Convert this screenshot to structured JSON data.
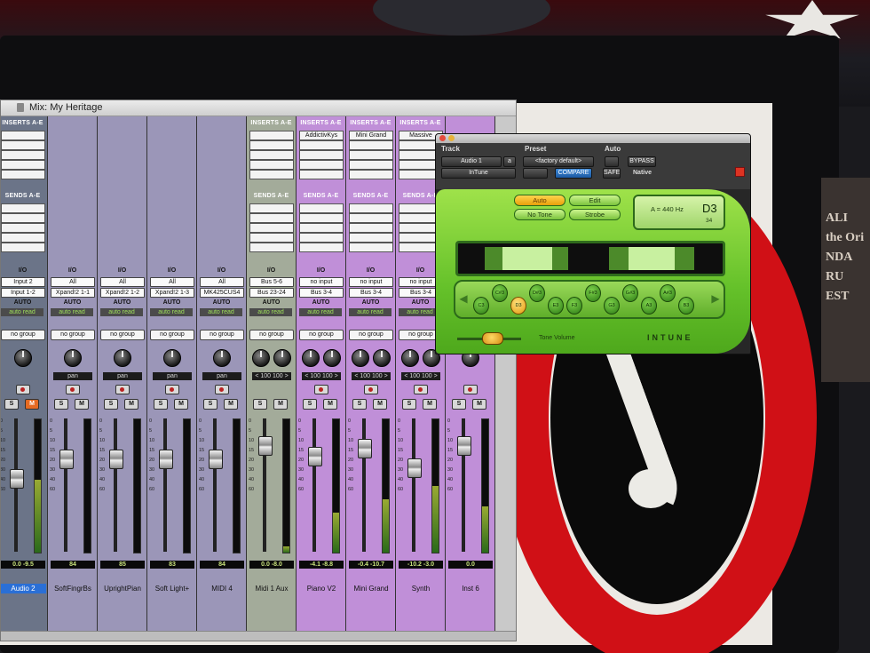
{
  "mix_window": {
    "title": "Mix: My Heritage",
    "strips": [
      {
        "color": "#6b7488",
        "inserts": "INSERTS A-E",
        "insert_slots": [],
        "sends": "SENDS A-E",
        "io": "I/O",
        "input": "Input 2",
        "output": "Input 1-2",
        "automation": "AUTO",
        "auto_mode": "auto read",
        "group": "no group",
        "pan": "",
        "vol_left": "0.0",
        "vol_right": "-9.5",
        "name": "Audio 2",
        "name_selected": true,
        "rec": true,
        "solo_active": false,
        "mute_active": true,
        "fader": 0.55,
        "meter": 0.55
      },
      {
        "color": "#9b96b8",
        "inserts": "",
        "insert_slots": [],
        "sends": "",
        "io": "I/O",
        "input": "All",
        "output": "Xpand!2 1-1",
        "automation": "AUTO",
        "auto_mode": "auto read",
        "group": "no group",
        "pan": "pan",
        "vol_left": "84",
        "vol_right": "",
        "name": "SoftFingrBs",
        "name_selected": false,
        "rec": true,
        "solo_active": false,
        "mute_active": false,
        "fader": 0.7,
        "meter": 0.0
      },
      {
        "color": "#9b96b8",
        "inserts": "",
        "insert_slots": [],
        "sends": "",
        "io": "I/O",
        "input": "All",
        "output": "Xpand!2 1-2",
        "automation": "AUTO",
        "auto_mode": "auto read",
        "group": "no group",
        "pan": "pan",
        "vol_left": "85",
        "vol_right": "",
        "name": "UprightPian",
        "name_selected": false,
        "rec": true,
        "solo_active": false,
        "mute_active": false,
        "fader": 0.7,
        "meter": 0.0
      },
      {
        "color": "#9b96b8",
        "inserts": "",
        "insert_slots": [],
        "sends": "",
        "io": "I/O",
        "input": "All",
        "output": "Xpand!2 1-3",
        "automation": "AUTO",
        "auto_mode": "auto read",
        "group": "no group",
        "pan": "pan",
        "vol_left": "83",
        "vol_right": "",
        "name": "Soft Light+",
        "name_selected": false,
        "rec": true,
        "solo_active": false,
        "mute_active": false,
        "fader": 0.7,
        "meter": 0.0
      },
      {
        "color": "#9b96b8",
        "inserts": "",
        "insert_slots": [],
        "sends": "",
        "io": "I/O",
        "input": "All",
        "output": "MK425CUS4",
        "automation": "AUTO",
        "auto_mode": "auto read",
        "group": "no group",
        "pan": "pan",
        "vol_left": "84",
        "vol_right": "",
        "name": "MIDI 4",
        "name_selected": false,
        "rec": true,
        "solo_active": false,
        "mute_active": false,
        "fader": 0.7,
        "meter": 0.0
      },
      {
        "color": "#a3ab9a",
        "inserts": "INSERTS A-E",
        "insert_slots": [],
        "sends": "SENDS A-E",
        "io": "I/O",
        "input": "Bus 5-6",
        "output": "Bus 23-24",
        "automation": "AUTO",
        "auto_mode": "auto read",
        "group": "no group",
        "pan": "< 100   100 >",
        "vol_left": "0.0",
        "vol_right": "-8.0",
        "name": "Midi 1 Aux",
        "name_selected": false,
        "rec": false,
        "solo_active": false,
        "mute_active": false,
        "fader": 0.8,
        "meter": 0.05
      },
      {
        "color": "#c08fd8",
        "inserts": "INSERTS A-E",
        "insert_slots": [
          "AddictivKys"
        ],
        "sends": "SENDS A-E",
        "io": "I/O",
        "input": "no input",
        "output": "Bus 3-4",
        "automation": "AUTO",
        "auto_mode": "auto read",
        "group": "no group",
        "pan": "< 100   100 >",
        "vol_left": "-4.1",
        "vol_right": "-8.8",
        "name": "Piano V2",
        "name_selected": false,
        "rec": true,
        "solo_active": false,
        "mute_active": false,
        "fader": 0.72,
        "meter": 0.3
      },
      {
        "color": "#c08fd8",
        "inserts": "INSERTS A-E",
        "insert_slots": [
          "Mini Grand"
        ],
        "sends": "SENDS A-E",
        "io": "I/O",
        "input": "no input",
        "output": "Bus 3-4",
        "automation": "AUTO",
        "auto_mode": "auto read",
        "group": "no group",
        "pan": "< 100   100 >",
        "vol_left": "-0.4",
        "vol_right": "-10.7",
        "name": "Mini Grand",
        "name_selected": false,
        "rec": true,
        "solo_active": false,
        "mute_active": false,
        "fader": 0.78,
        "meter": 0.4
      },
      {
        "color": "#c08fd8",
        "inserts": "INSERTS A-E",
        "insert_slots": [
          "Massive"
        ],
        "sends": "SENDS A-E",
        "io": "I/O",
        "input": "no input",
        "output": "Bus 3-4",
        "automation": "AUTO",
        "auto_mode": "auto read",
        "group": "no group",
        "pan": "< 100   100 >",
        "vol_left": "-10.2",
        "vol_right": "-3.0",
        "name": "Synth",
        "name_selected": false,
        "rec": true,
        "solo_active": false,
        "mute_active": false,
        "fader": 0.63,
        "meter": 0.5
      },
      {
        "color": "#c08fd8",
        "inserts": "",
        "insert_slots": [],
        "sends": "",
        "io": "I/O",
        "input": "no input",
        "output": "",
        "automation": "AUTO",
        "auto_mode": "auto read",
        "group": "no group",
        "pan": "",
        "vol_left": "0.0",
        "vol_right": "",
        "name": "Inst 6",
        "name_selected": false,
        "rec": true,
        "solo_active": false,
        "mute_active": false,
        "fader": 0.8,
        "meter": 0.35
      }
    ],
    "fader_scale": [
      "0",
      "5",
      "10",
      "15",
      "20",
      "30",
      "40",
      "60"
    ],
    "rec_solo_mute": {
      "solo": "S",
      "mute": "M"
    }
  },
  "plugin": {
    "track_label": "Track",
    "preset_label": "Preset",
    "auto_label": "Auto",
    "track_name": "Audio 1",
    "track_letter": "a",
    "preset_name": "<factory default>",
    "plugin_name": "InTune",
    "compare_label": "COMPARE",
    "safe_label": "SAFE",
    "bypass_label": "BYPASS",
    "native_label": "Native",
    "auto_btn": "Auto",
    "edit_btn": "Edit",
    "tone_btn": "No Tone",
    "strobe_btn": "Strobe",
    "reference": "A = 440 Hz",
    "note": "D3",
    "cents": "34",
    "notes": [
      "C3",
      "C#3",
      "D3",
      "D#3",
      "E3",
      "F3",
      "F#3",
      "G3",
      "G#3",
      "A3",
      "A#3",
      "B3"
    ],
    "active_note": "D3",
    "tone_volume_label": "Tone Volume",
    "brand": "INTUNE"
  },
  "background": {
    "poster_lines": [
      "ALI",
      "the Ori",
      "NDA",
      "RU",
      "EST"
    ]
  },
  "colors": {
    "plugin_green": "#7ccc35",
    "active_note": "#f0b020",
    "mix_selected_name": "#2a6fd6"
  }
}
